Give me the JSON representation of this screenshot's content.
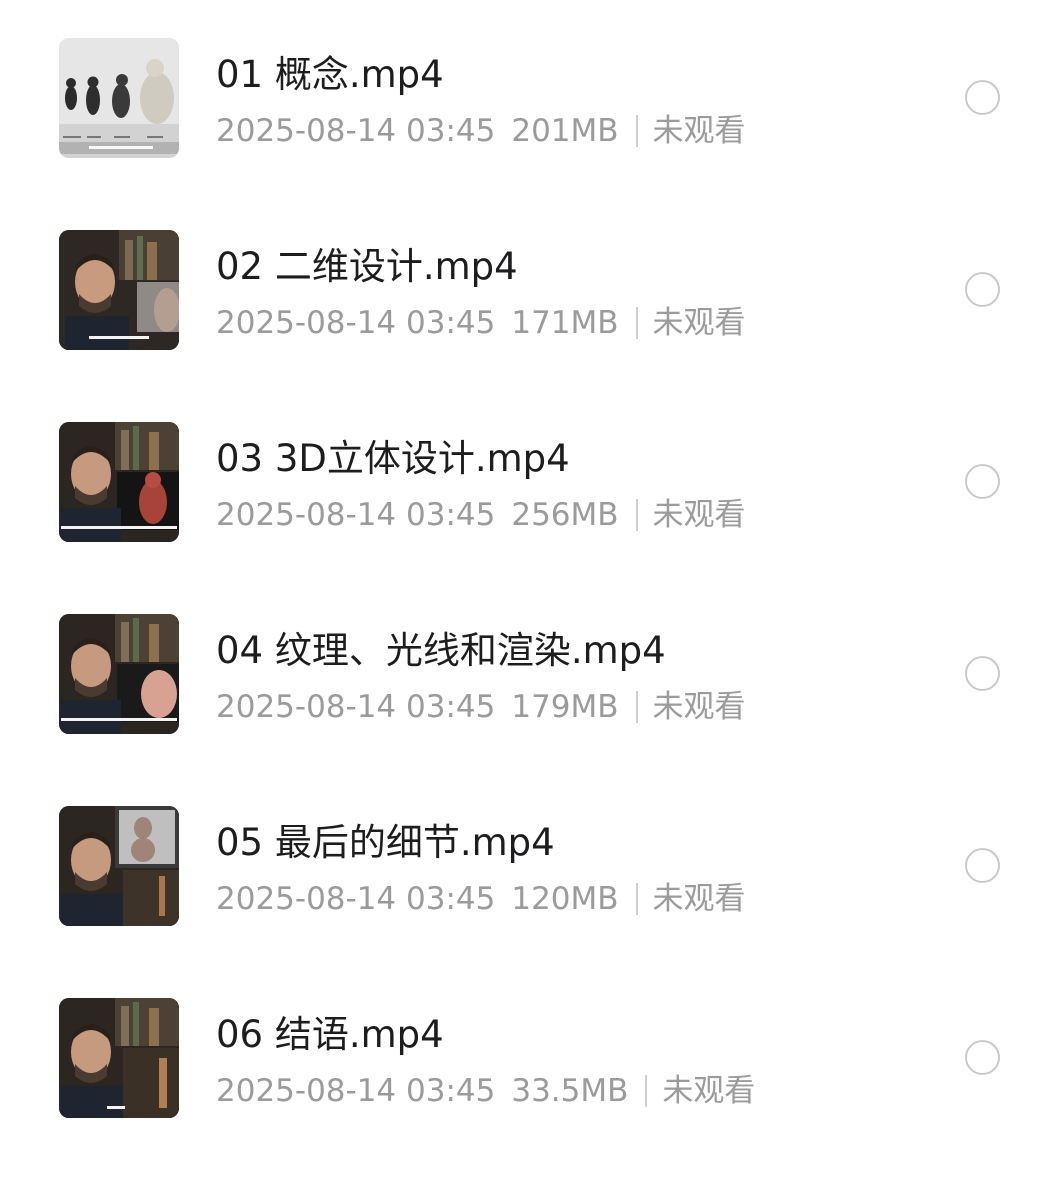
{
  "files": [
    {
      "name": "01 概念.mp4",
      "date": "2025-08-14 03:45",
      "size": "201MB",
      "status": "未观看",
      "thumbnail": "apes-lineup-thumbnail"
    },
    {
      "name": "02 二维设计.mp4",
      "date": "2025-08-14 03:45",
      "size": "171MB",
      "status": "未观看",
      "thumbnail": "presenter-thumbnail"
    },
    {
      "name": "03 3D立体设计.mp4",
      "date": "2025-08-14 03:45",
      "size": "256MB",
      "status": "未观看",
      "thumbnail": "presenter-thumbnail"
    },
    {
      "name": "04 纹理、光线和渲染.mp4",
      "date": "2025-08-14 03:45",
      "size": "179MB",
      "status": "未观看",
      "thumbnail": "presenter-thumbnail"
    },
    {
      "name": "05 最后的细节.mp4",
      "date": "2025-08-14 03:45",
      "size": "120MB",
      "status": "未观看",
      "thumbnail": "presenter-thumbnail"
    },
    {
      "name": "06 结语.mp4",
      "date": "2025-08-14 03:45",
      "size": "33.5MB",
      "status": "未观看",
      "thumbnail": "presenter-thumbnail"
    }
  ],
  "colors": {
    "title_text": "#1d1d1f",
    "meta_text": "#9b9b9b",
    "radio_border": "#c9c9c9",
    "background": "#ffffff"
  }
}
